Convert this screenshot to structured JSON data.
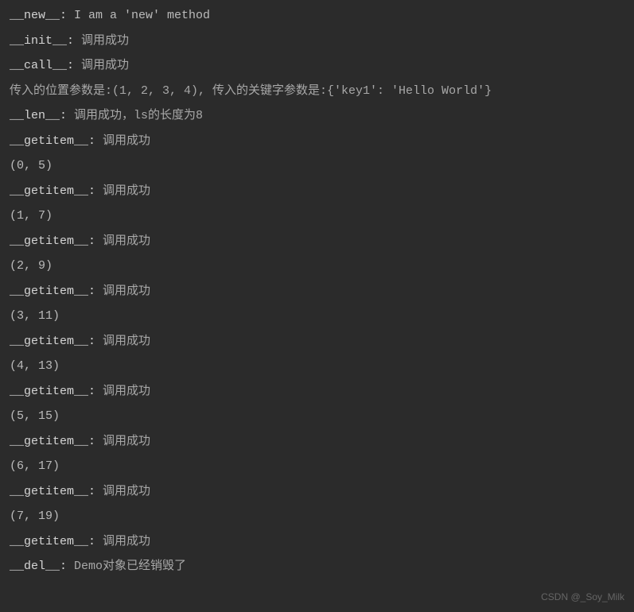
{
  "lines": {
    "l0_method": "__new__:",
    "l0_text": " I am a 'new' method",
    "l1_method": "__init__:",
    "l1_text": " 调用成功",
    "l2_method": "__call__:",
    "l2_text": " 调用成功",
    "l3_a": "传入的位置参数是:(1, 2, 3, 4",
    "l3_b": "), 传入的关键字参数是:{'key1': 'Hello World'}",
    "l4_method": "__len__:",
    "l4_text": " 调用成功，ls的长度为8",
    "l5_method": "__getitem__:",
    "l5_text": " 调用成功",
    "l6": "(0, 5)",
    "l7_method": "__getitem__:",
    "l7_text": " 调用成功",
    "l8": "(1, 7)",
    "l9_method": "__getitem__:",
    "l9_text": " 调用成功",
    "l10": "(2, 9)",
    "l11_method": "__getitem__:",
    "l11_text": " 调用成功",
    "l12": "(3, 11)",
    "l13_method": "__getitem__:",
    "l13_text": " 调用成功",
    "l14": "(4, 13)",
    "l15_method": "__getitem__:",
    "l15_text": " 调用成功",
    "l16": "(5, 15)",
    "l17_method": "__getitem__:",
    "l17_text": " 调用成功",
    "l18": "(6, 17)",
    "l19_method": "__getitem__:",
    "l19_text": " 调用成功",
    "l20": "(7, 19)",
    "l21_method": "__getitem__:",
    "l21_text": " 调用成功",
    "l22_method": "__del__:",
    "l22_text": " Demo对象已经销毁了"
  },
  "watermark": "CSDN @_Soy_Milk"
}
